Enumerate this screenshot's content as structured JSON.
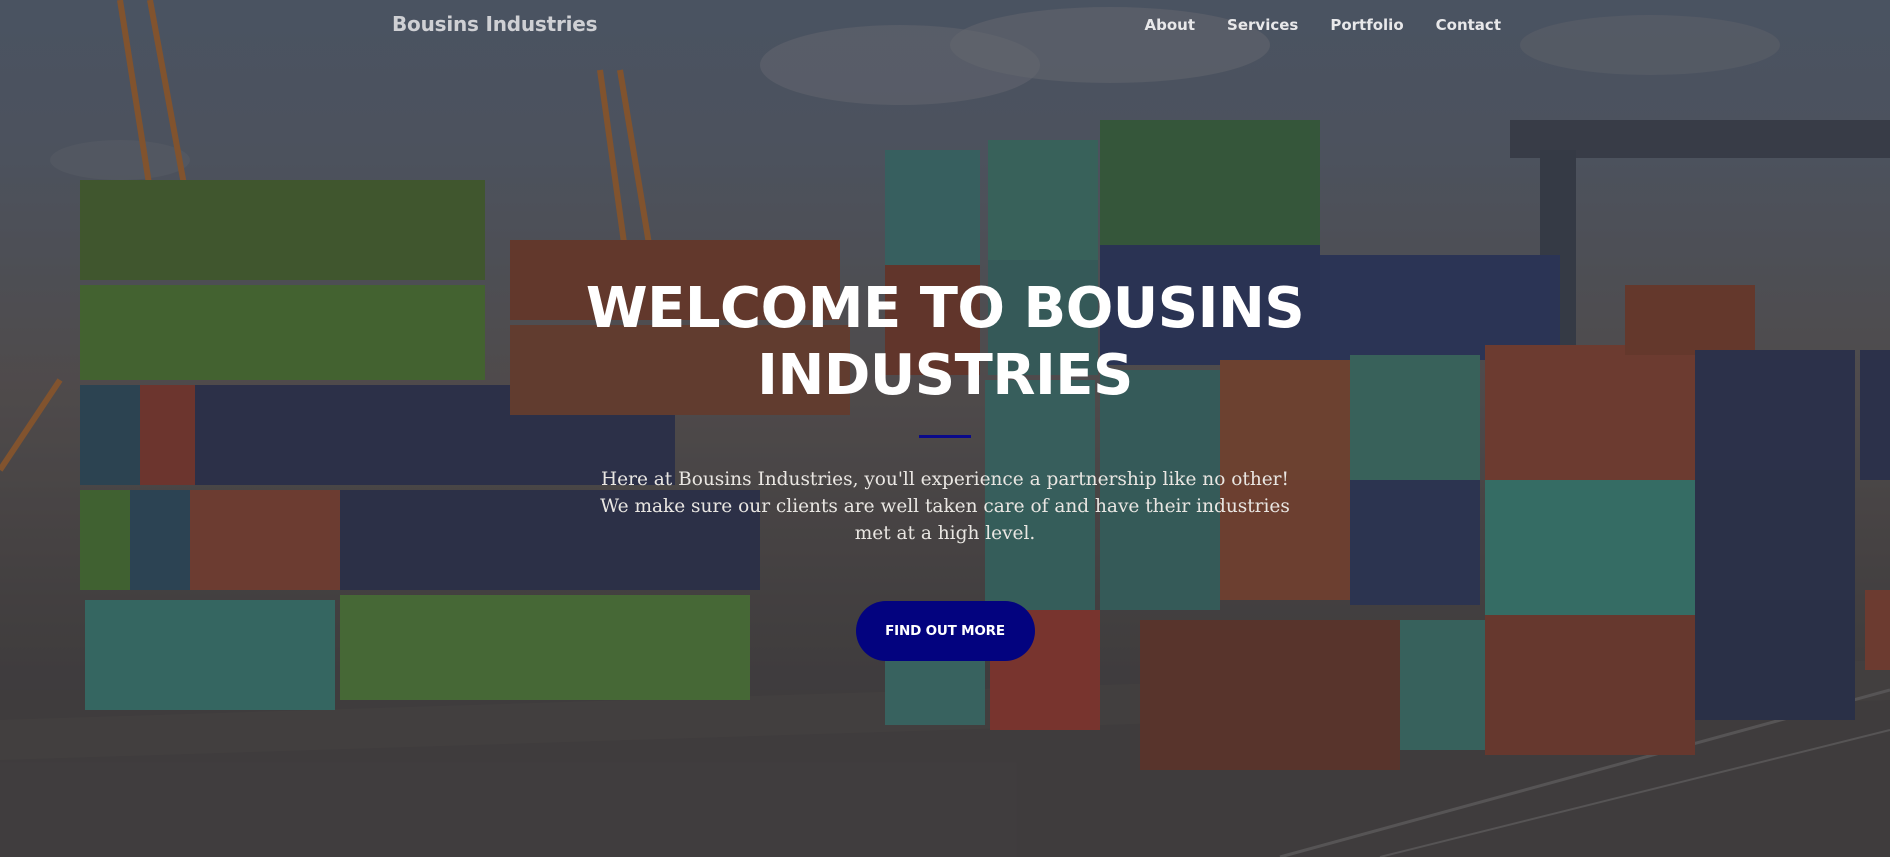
{
  "navbar": {
    "brand": "Bousins Industries",
    "links": [
      {
        "label": "About"
      },
      {
        "label": "Services"
      },
      {
        "label": "Portfolio"
      },
      {
        "label": "Contact"
      }
    ]
  },
  "hero": {
    "title_line1": "WELCOME TO BOUSINS",
    "title_line2": "INDUSTRIES",
    "lead": "Here at Bousins Industries, you'll experience a partnership like no other! We make sure our clients are well taken care of and have their industries met at a high level.",
    "cta_label": "FIND OUT MORE"
  },
  "colors": {
    "accent": "#03037f",
    "divider": "#0a0a8a",
    "title_text": "#ffffff"
  }
}
